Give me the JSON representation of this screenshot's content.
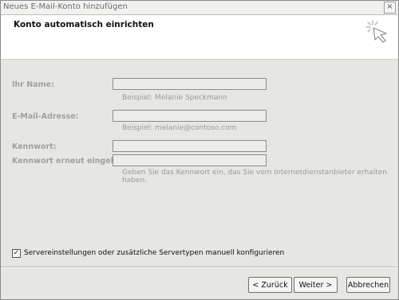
{
  "window": {
    "title": "Neues E-Mail-Konto hinzufügen",
    "close_glyph": "×"
  },
  "header": {
    "title": "Konto automatisch einrichten",
    "icon": "cursor-sparkle-icon"
  },
  "form": {
    "name_label": "Ihr Name:",
    "name_hint": "Beispiel: Melanie Speckmann",
    "email_label": "E-Mail-Adresse:",
    "email_hint": "Beispiel: melanie@contoso.com",
    "password_label": "Kennwort:",
    "password_repeat_label": "Kennwort erneut eingeben:",
    "password_hint": "Geben Sie das Kennwort ein, das Sie vom Internetdienstanbieter erhalten haben."
  },
  "manual_config": {
    "checked": true,
    "check_glyph": "✓",
    "label": "Servereinstellungen oder zusätzliche Servertypen manuell konfigurieren"
  },
  "buttons": {
    "back": "< Zurück",
    "next": "Weiter >",
    "cancel": "Abbrechen"
  }
}
